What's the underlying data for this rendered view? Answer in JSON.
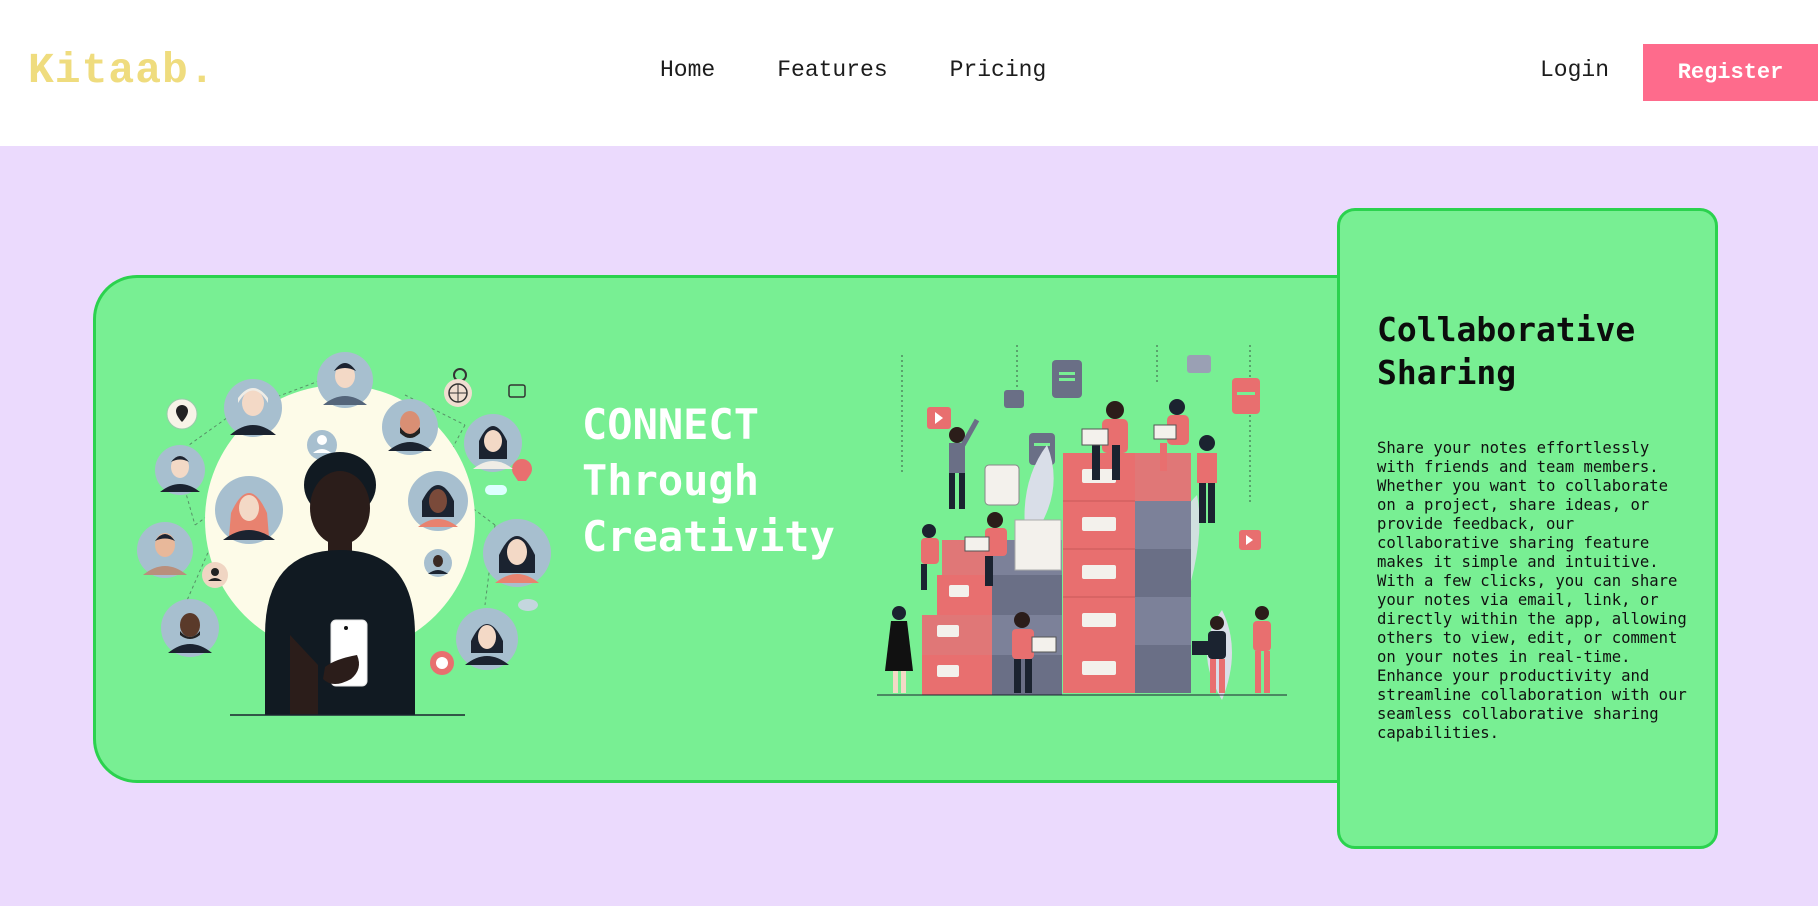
{
  "brand": {
    "logo": "Kitaab."
  },
  "nav": {
    "links": [
      "Home",
      "Features",
      "Pricing"
    ],
    "login": "Login",
    "register": "Register"
  },
  "hero": {
    "headline_lines": [
      "CONNECT",
      "Through",
      "Creativity"
    ]
  },
  "feature": {
    "title_lines": [
      "Collaborative",
      "Sharing"
    ],
    "body": "Share your notes effortlessly with friends and team members. Whether you want to collaborate on a project, share ideas, or provide feedback, our collaborative sharing feature makes it simple and intuitive. With a few clicks, you can share your notes via email, link, or directly within the app, allowing others to view, edit, or comment on your notes in real-time. Enhance your productivity and streamline collaboration with our seamless collaborative sharing capabilities."
  },
  "colors": {
    "logo": "#efdc7e",
    "register_bg": "#fe6b8c",
    "hero_bg": "#ebdafd",
    "card_bg": "#78ef93",
    "card_border": "#2bd24e",
    "accent_coral": "#e86f6f"
  },
  "illustrations": {
    "left": "social-network-illustration",
    "right": "team-filing-cabinets-illustration"
  }
}
